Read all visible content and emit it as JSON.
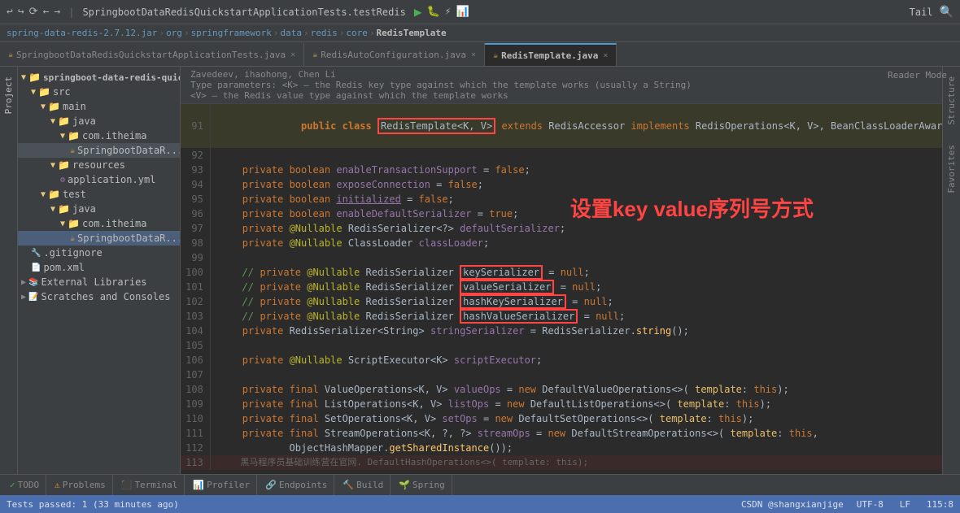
{
  "topbar": {
    "title": "SpringbootDataRedisQuickstartApplicationTests.testRedis",
    "tail_label": "Tail",
    "search_icon": "🔍"
  },
  "breadcrumb": {
    "parts": [
      "spring-data-redis-2.7.12.jar",
      "org",
      "springframework",
      "data",
      "redis",
      "core",
      "RedisTemplate"
    ]
  },
  "tabs": [
    {
      "label": "SpringbootDataRedisQuickstartApplicationTests.java",
      "active": false
    },
    {
      "label": "RedisAutoConfiguration.java",
      "active": false
    },
    {
      "label": "RedisTemplate.java",
      "active": true
    }
  ],
  "reader_mode": "Reader Mode",
  "code_info": {
    "authors": "Zavedeev, ihaohong, Chen Li",
    "param1": "Type parameters: <K> – the Redis key type against which the template works (usually a String)",
    "param2": "<V> – the Redis value type against which the template works"
  },
  "chinese_annotation": "设置key value序列号方式",
  "code_lines": [
    {
      "num": "91",
      "content": "public class <RedisTemplate<K, V>> extends RedisAccessor implements RedisOperations<K, V>, BeanClassLoaderAware {",
      "has_highlight": true,
      "highlight_text": "RedisTemplate<K, V>"
    },
    {
      "num": "92",
      "content": ""
    },
    {
      "num": "93",
      "content": "    private boolean enableTransactionSupport = false;"
    },
    {
      "num": "94",
      "content": "    private boolean exposeConnection = false;"
    },
    {
      "num": "95",
      "content": "    private boolean initialized = false;"
    },
    {
      "num": "96",
      "content": "    private boolean enableDefaultSerializer = true;"
    },
    {
      "num": "97",
      "content": "    private @Nullable RedisSerializer<?> defaultSerializer;"
    },
    {
      "num": "98",
      "content": "    private @Nullable ClassLoader classLoader;"
    },
    {
      "num": "99",
      "content": ""
    },
    {
      "num": "100",
      "content": "    //<rawtypes/> private @Nullable RedisSerializer <keySerializer> = null;",
      "has_highlight": true,
      "highlight_text": "keySerializer"
    },
    {
      "num": "101",
      "content": "    //<rawtypes/> private @Nullable RedisSerializer <valueSerializer> = null;",
      "has_highlight": true,
      "highlight_text": "valueSerializer"
    },
    {
      "num": "102",
      "content": "    //<rawtypes/> private @Nullable RedisSerializer <hashKeySerializer> = null;",
      "has_highlight": true,
      "highlight_text": "hashKeySerializer"
    },
    {
      "num": "103",
      "content": "    //<rawtypes/> private @Nullable RedisSerializer <hashValueSerializer> = null;",
      "has_highlight": true,
      "highlight_text": "hashValueSerializer"
    },
    {
      "num": "104",
      "content": "    private RedisSerializer<String> stringSerializer = RedisSerializer.string();"
    },
    {
      "num": "105",
      "content": ""
    },
    {
      "num": "106",
      "content": "    private @Nullable ScriptExecutor<K> scriptExecutor;"
    },
    {
      "num": "107",
      "content": ""
    },
    {
      "num": "108",
      "content": "    private final ValueOperations<K, V> valueOps = new DefaultValueOperations<>( template: this);"
    },
    {
      "num": "109",
      "content": "    private final ListOperations<K, V> listOps = new DefaultListOperations<>( template: this);"
    },
    {
      "num": "110",
      "content": "    private final SetOperations<K, V> setOps = new DefaultSetOperations<>( template: this);"
    },
    {
      "num": "111",
      "content": "    private final StreamOperations<K, ?, ?> streamOps = new DefaultStreamOperations<>( template: this,"
    },
    {
      "num": "112",
      "content": "            ObjectHashMapper.getSharedInstance());"
    },
    {
      "num": "113",
      "content": "    黑马程序员基础训练营在官网. DefaultHashOperations<>( template: this);"
    }
  ],
  "sidebar": {
    "title": "Project",
    "tree": [
      {
        "label": "springboot-data-redis-quickstart",
        "indent": 0,
        "icon": "folder",
        "expanded": true
      },
      {
        "label": "src",
        "indent": 1,
        "icon": "folder",
        "expanded": true
      },
      {
        "label": "main",
        "indent": 2,
        "icon": "folder",
        "expanded": true
      },
      {
        "label": "java",
        "indent": 3,
        "icon": "folder",
        "expanded": true
      },
      {
        "label": "com.itheima",
        "indent": 4,
        "icon": "folder",
        "expanded": true
      },
      {
        "label": "SpringbootDataR...",
        "indent": 5,
        "icon": "java"
      },
      {
        "label": "resources",
        "indent": 3,
        "icon": "folder",
        "expanded": true
      },
      {
        "label": "application.yml",
        "indent": 4,
        "icon": "yaml"
      },
      {
        "label": "test",
        "indent": 2,
        "icon": "folder",
        "expanded": true
      },
      {
        "label": "java",
        "indent": 3,
        "icon": "folder",
        "expanded": true
      },
      {
        "label": "com.itheima",
        "indent": 4,
        "icon": "folder",
        "expanded": true
      },
      {
        "label": "SpringbootDataR...",
        "indent": 5,
        "icon": "java",
        "selected": true
      },
      {
        "label": ".gitignore",
        "indent": 1,
        "icon": "git"
      },
      {
        "label": "pom.xml",
        "indent": 1,
        "icon": "xml"
      },
      {
        "label": "External Libraries",
        "indent": 0,
        "icon": "ext"
      },
      {
        "label": "Scratches and Consoles",
        "indent": 0,
        "icon": "scratch"
      }
    ]
  },
  "bottom_tabs": [
    {
      "label": "TODO",
      "icon": "✓"
    },
    {
      "label": "Problems",
      "icon": "⚠"
    },
    {
      "label": "Terminal",
      "icon": ">"
    },
    {
      "label": "Profiler",
      "icon": "📊"
    },
    {
      "label": "Endpoints",
      "icon": "🔗"
    },
    {
      "label": "Build",
      "icon": "🔨"
    },
    {
      "label": "Spring",
      "icon": "🌱"
    }
  ],
  "status_bar": {
    "left": "Tests passed: 1 (33 minutes ago)",
    "right": "CSDN @shangxianjige  UTF-8  LF  115:8",
    "csdn": "CSDN @shangxianjige"
  },
  "side_labels": [
    "Project",
    "Structure",
    "Favorites"
  ]
}
